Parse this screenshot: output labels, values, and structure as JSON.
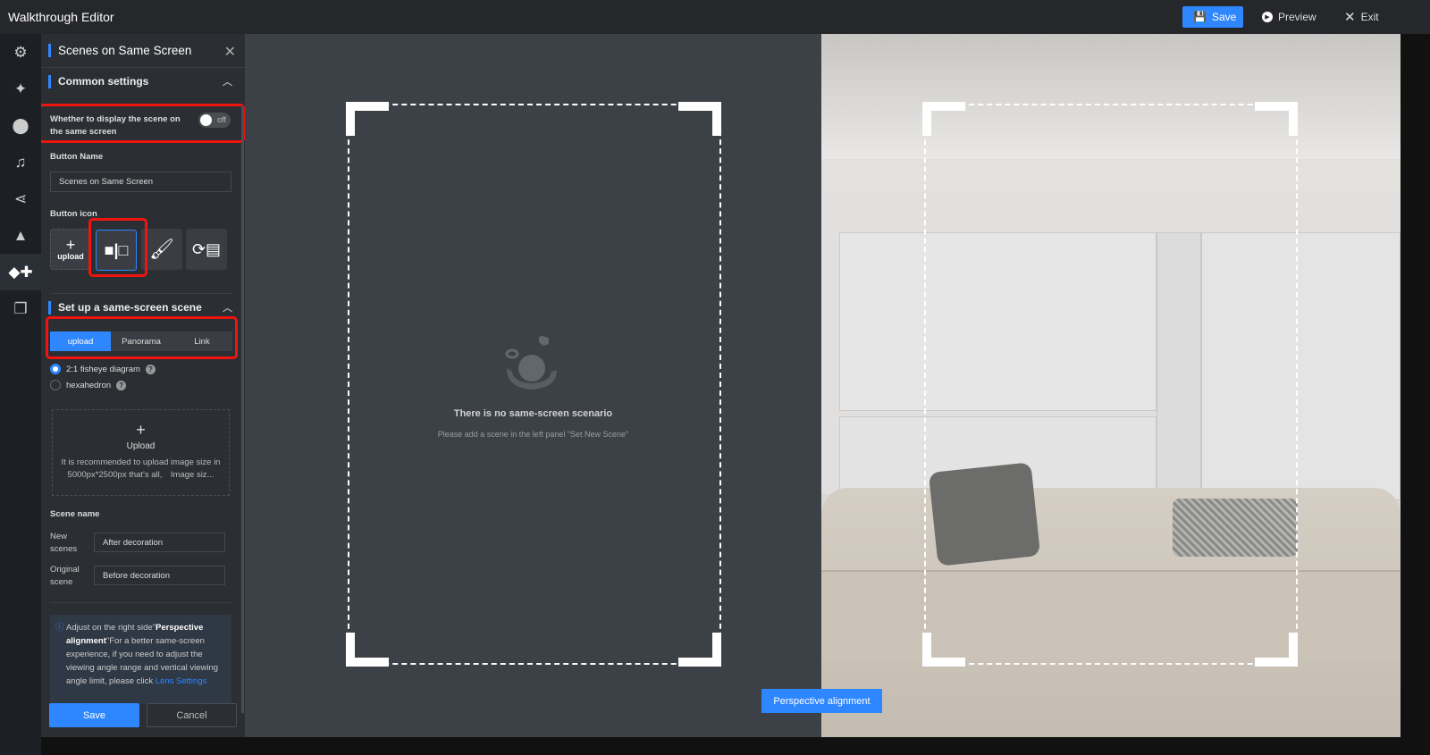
{
  "app": {
    "title": "Walkthrough Editor"
  },
  "toolbar": {
    "save": "Save",
    "preview": "Preview",
    "exit": "Exit"
  },
  "rail": [
    "gear-icon",
    "magic-wand-icon",
    "location-pin-icon",
    "music-icon",
    "share-icon",
    "bag-icon",
    "widgets-icon",
    "layers-icon"
  ],
  "panel": {
    "title": "Scenes on Same Screen",
    "common_settings": "Common settings",
    "display_toggle_label": "Whether to display the scene on the same screen",
    "toggle_state": "off",
    "button_name_label": "Button Name",
    "button_name_value": "Scenes on Same Screen",
    "button_icon_label": "Button icon",
    "upload_label": "upload",
    "setup_title": "Set up a same-screen scene",
    "tabs": [
      "upload",
      "Panorama",
      "Link"
    ],
    "radios": [
      "2:1 fisheye diagram",
      "hexahedron"
    ],
    "upload_box": {
      "title": "Upload",
      "hint": "It is recommended to upload image size in 5000px*2500px that's all,　Image siz..."
    },
    "scene_name_label": "Scene name",
    "new_scenes_label": "New scenes",
    "new_scenes_value": "After decoration",
    "original_scene_label": "Original scene",
    "original_scene_value": "Before decoration",
    "note": {
      "pre": "Adjust on the right side\"",
      "bold": "Perspective alignment",
      "mid": "\"For a better same-screen experience, if you need to adjust the viewing angle range and vertical viewing angle limit, please click ",
      "link": "Lens Settings"
    },
    "save": "Save",
    "cancel": "Cancel"
  },
  "canvas": {
    "empty_title": "There is no same-screen scenario",
    "empty_hint": "Please add a scene in the left panel \"Set New Scene\"",
    "perspective_button": "Perspective alignment"
  },
  "colors": {
    "accent": "#2f87ff",
    "highlight": "#f0140f"
  }
}
